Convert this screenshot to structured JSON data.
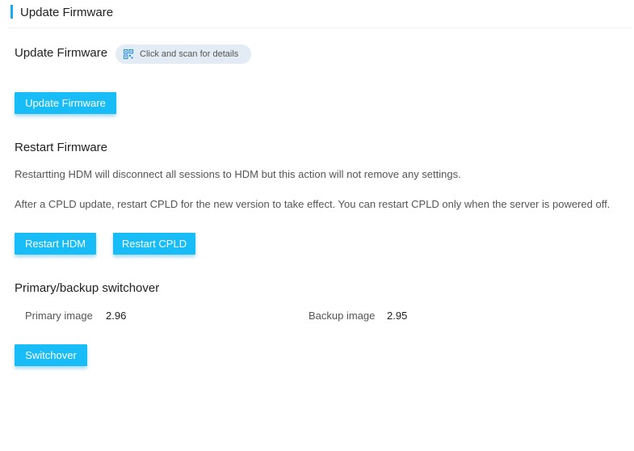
{
  "header": {
    "title": "Update Firmware",
    "accent": "#1aa8f0"
  },
  "update": {
    "title": "Update Firmware",
    "scan_hint": "Click and scan for details",
    "button": "Update Firmware"
  },
  "restart": {
    "title": "Restart Firmware",
    "desc1": "Restartting HDM will disconnect all sessions to HDM but this action will not remove any settings.",
    "desc2": "After a CPLD update, restart CPLD for the new version to take effect. You can restart CPLD only when the server is powered off.",
    "hdm_button": "Restart HDM",
    "cpld_button": "Restart CPLD"
  },
  "switchover": {
    "title": "Primary/backup switchover",
    "primary_label": "Primary image",
    "primary_value": "2.96",
    "backup_label": "Backup image",
    "backup_value": "2.95",
    "button": "Switchover"
  },
  "colors": {
    "button": "#18bdf7",
    "pill": "#e3ebf5"
  }
}
